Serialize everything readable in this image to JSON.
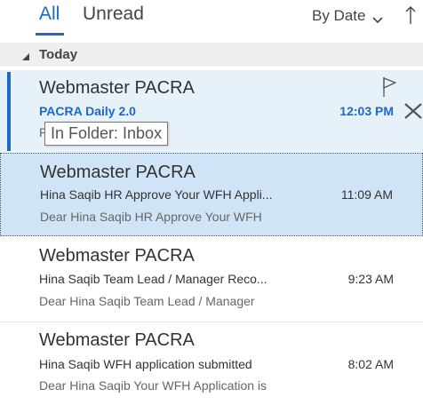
{
  "filter": {
    "tab_all": "All",
    "tab_unread": "Unread",
    "sort_label": "By Date",
    "sort_chevron_icon": "chevron-down-icon",
    "sort_direction_icon": "arrow-up-icon"
  },
  "group": {
    "label": "Today"
  },
  "messages": [
    {
      "sender": "Webmaster PACRA",
      "subject": "PACRA Daily 2.0",
      "time": "12:03 PM",
      "preview": "P",
      "unread": true
    },
    {
      "sender": "Webmaster PACRA",
      "subject": "Hina Saqib HR Approve Your WFH Appli...",
      "time": "11:09 AM",
      "preview": "Dear Hina Saqib  HR Approve Your WFH",
      "unread": false
    },
    {
      "sender": "Webmaster PACRA",
      "subject": "Hina Saqib Team Lead / Manager Reco...",
      "time": "9:23 AM",
      "preview": "Dear Hina Saqib  Team Lead / Manager",
      "unread": false
    },
    {
      "sender": "Webmaster PACRA",
      "subject": "Hina Saqib WFH application submitted",
      "time": "8:02 AM",
      "preview": "Dear Hina Saqib  Your WFH Application is",
      "unread": false
    }
  ],
  "tooltip": {
    "text": "In Folder: Inbox"
  },
  "colors": {
    "accent": "#1b6ac9",
    "hover_bg": "#e6f1fa",
    "selected_bg": "#cfe4f6",
    "group_bg": "#efefef"
  }
}
